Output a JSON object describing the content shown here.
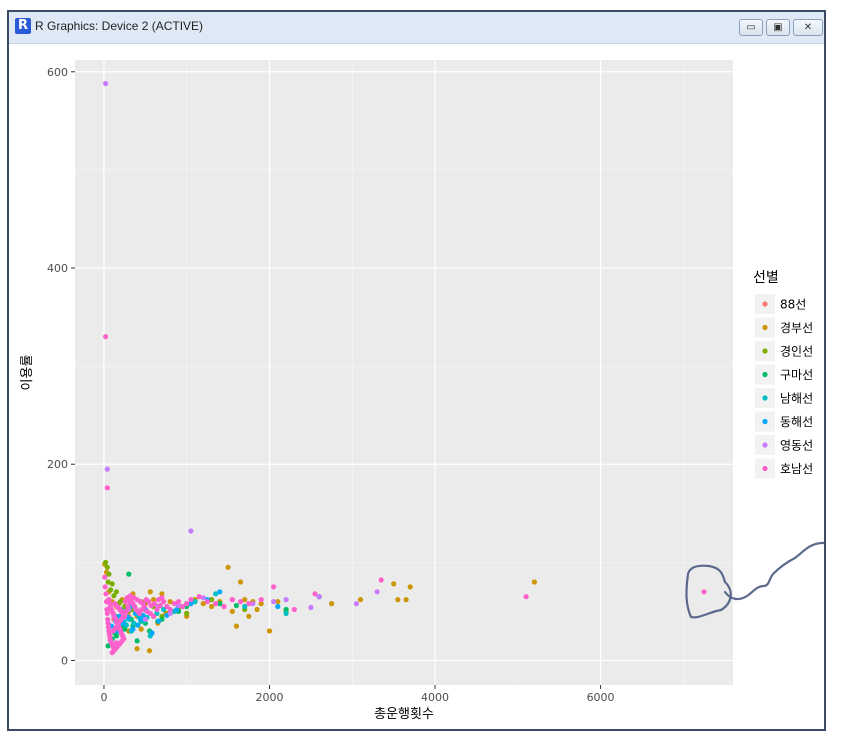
{
  "window": {
    "title": "R Graphics: Device 2 (ACTIVE)",
    "app_icon_glyph": "R",
    "minimize_glyph": "▭",
    "maximize_glyph": "▣",
    "close_glyph": "✕"
  },
  "chart_data": {
    "type": "scatter",
    "title": "",
    "xlabel": "총운행횟수",
    "ylabel": "이용률",
    "xlim": [
      -350,
      7600
    ],
    "ylim": [
      -25,
      612
    ],
    "x_ticks": [
      0,
      2000,
      4000,
      6000
    ],
    "y_ticks": [
      0,
      200,
      400,
      600
    ],
    "x_tick_labels": [
      "0",
      "2000",
      "4000",
      "6000"
    ],
    "y_tick_labels": [
      "0",
      "200",
      "400",
      "600"
    ],
    "grid": true,
    "background": "#ebebeb",
    "legend": {
      "title": "선별",
      "position": "right"
    },
    "series": [
      {
        "name": "88선",
        "color": "#F8766D",
        "points": [
          [
            120,
            42
          ],
          [
            180,
            38
          ],
          [
            240,
            50
          ],
          [
            300,
            45
          ]
        ]
      },
      {
        "name": "경부선",
        "color": "#CD9600",
        "points": [
          [
            10,
            98
          ],
          [
            30,
            90
          ],
          [
            60,
            70
          ],
          [
            100,
            60
          ],
          [
            150,
            55
          ],
          [
            220,
            62
          ],
          [
            280,
            50
          ],
          [
            350,
            68
          ],
          [
            400,
            45
          ],
          [
            450,
            60
          ],
          [
            500,
            58
          ],
          [
            560,
            70
          ],
          [
            600,
            62
          ],
          [
            650,
            55
          ],
          [
            700,
            68
          ],
          [
            750,
            48
          ],
          [
            800,
            60
          ],
          [
            900,
            55
          ],
          [
            1000,
            45
          ],
          [
            1100,
            62
          ],
          [
            1200,
            58
          ],
          [
            1300,
            55
          ],
          [
            1400,
            60
          ],
          [
            1500,
            95
          ],
          [
            1550,
            50
          ],
          [
            1600,
            35
          ],
          [
            1650,
            80
          ],
          [
            1700,
            62
          ],
          [
            1750,
            45
          ],
          [
            1800,
            60
          ],
          [
            1850,
            52
          ],
          [
            1900,
            58
          ],
          [
            2000,
            30
          ],
          [
            2100,
            60
          ],
          [
            2200,
            50
          ],
          [
            2600,
            65
          ],
          [
            2750,
            58
          ],
          [
            3100,
            62
          ],
          [
            3500,
            78
          ],
          [
            3550,
            62
          ],
          [
            3650,
            62
          ],
          [
            3700,
            75
          ],
          [
            5200,
            80
          ],
          [
            300,
            30
          ],
          [
            400,
            12
          ],
          [
            550,
            10
          ],
          [
            650,
            38
          ],
          [
            450,
            32
          ],
          [
            1000,
            58
          ],
          [
            1300,
            62
          ]
        ]
      },
      {
        "name": "경인선",
        "color": "#7CAE00",
        "points": [
          [
            20,
            100
          ],
          [
            40,
            95
          ],
          [
            60,
            88
          ],
          [
            100,
            78
          ],
          [
            150,
            70
          ],
          [
            200,
            60
          ],
          [
            250,
            55
          ],
          [
            300,
            50
          ],
          [
            400,
            48
          ],
          [
            500,
            60
          ],
          [
            600,
            55
          ],
          [
            700,
            45
          ],
          [
            800,
            50
          ],
          [
            900,
            52
          ],
          [
            1000,
            48
          ],
          [
            1100,
            60
          ],
          [
            1300,
            62
          ],
          [
            1700,
            52
          ],
          [
            50,
            80
          ],
          [
            80,
            72
          ],
          [
            120,
            66
          ],
          [
            180,
            58
          ],
          [
            350,
            52
          ],
          [
            450,
            46
          ]
        ]
      },
      {
        "name": "구마선",
        "color": "#00BE67",
        "points": [
          [
            50,
            15
          ],
          [
            100,
            22
          ],
          [
            150,
            25
          ],
          [
            200,
            30
          ],
          [
            250,
            32
          ],
          [
            300,
            88
          ],
          [
            350,
            35
          ],
          [
            400,
            20
          ],
          [
            450,
            40
          ],
          [
            500,
            38
          ],
          [
            600,
            45
          ],
          [
            700,
            42
          ],
          [
            900,
            50
          ],
          [
            1000,
            55
          ],
          [
            2200,
            52
          ],
          [
            2600,
            65
          ],
          [
            130,
            28
          ],
          [
            220,
            35
          ],
          [
            330,
            42
          ],
          [
            550,
            30
          ],
          [
            650,
            40
          ],
          [
            800,
            48
          ],
          [
            1400,
            58
          ],
          [
            1600,
            56
          ]
        ]
      },
      {
        "name": "남해선",
        "color": "#00BFC4",
        "points": [
          [
            80,
            20
          ],
          [
            120,
            30
          ],
          [
            180,
            35
          ],
          [
            240,
            40
          ],
          [
            300,
            42
          ],
          [
            360,
            38
          ],
          [
            420,
            45
          ],
          [
            480,
            40
          ],
          [
            560,
            25
          ],
          [
            640,
            48
          ],
          [
            720,
            52
          ],
          [
            850,
            50
          ],
          [
            950,
            55
          ],
          [
            1100,
            60
          ],
          [
            1350,
            68
          ],
          [
            1700,
            55
          ],
          [
            2200,
            48
          ],
          [
            150,
            45
          ],
          [
            200,
            52
          ],
          [
            270,
            36
          ],
          [
            330,
            30
          ],
          [
            390,
            48
          ],
          [
            460,
            52
          ],
          [
            520,
            44
          ]
        ]
      },
      {
        "name": "동해선",
        "color": "#00A9FF",
        "points": [
          [
            90,
            35
          ],
          [
            140,
            40
          ],
          [
            190,
            45
          ],
          [
            260,
            50
          ],
          [
            320,
            55
          ],
          [
            380,
            48
          ],
          [
            440,
            42
          ],
          [
            500,
            52
          ],
          [
            580,
            28
          ],
          [
            660,
            40
          ],
          [
            760,
            46
          ],
          [
            880,
            52
          ],
          [
            1050,
            58
          ],
          [
            1250,
            62
          ],
          [
            1400,
            70
          ],
          [
            2100,
            55
          ],
          [
            170,
            30
          ],
          [
            230,
            38
          ],
          [
            290,
            44
          ],
          [
            350,
            32
          ],
          [
            410,
            36
          ],
          [
            470,
            46
          ]
        ]
      },
      {
        "name": "영동선",
        "color": "#C77CFF",
        "points": [
          [
            20,
            588
          ],
          [
            40,
            195
          ],
          [
            1050,
            132
          ],
          [
            1550,
            62
          ],
          [
            2050,
            60
          ],
          [
            2600,
            65
          ],
          [
            3050,
            58
          ],
          [
            3300,
            70
          ],
          [
            650,
            55
          ],
          [
            800,
            48
          ],
          [
            120,
            45
          ],
          [
            300,
            52
          ],
          [
            500,
            42
          ],
          [
            900,
            56
          ],
          [
            1200,
            64
          ],
          [
            1800,
            58
          ],
          [
            2200,
            62
          ],
          [
            2500,
            54
          ]
        ]
      },
      {
        "name": "호남선",
        "color": "#FF61CC",
        "points": [
          [
            20,
            330
          ],
          [
            40,
            176
          ],
          [
            10,
            85
          ],
          [
            15,
            75
          ],
          [
            25,
            68
          ],
          [
            30,
            60
          ],
          [
            35,
            52
          ],
          [
            40,
            48
          ],
          [
            45,
            42
          ],
          [
            50,
            38
          ],
          [
            55,
            34
          ],
          [
            60,
            30
          ],
          [
            65,
            28
          ],
          [
            70,
            25
          ],
          [
            75,
            22
          ],
          [
            80,
            20
          ],
          [
            90,
            18
          ],
          [
            100,
            16
          ],
          [
            110,
            14
          ],
          [
            120,
            12
          ],
          [
            130,
            14
          ],
          [
            140,
            16
          ],
          [
            150,
            18
          ],
          [
            60,
            62
          ],
          [
            70,
            58
          ],
          [
            80,
            55
          ],
          [
            90,
            52
          ],
          [
            100,
            50
          ],
          [
            110,
            48
          ],
          [
            120,
            46
          ],
          [
            130,
            44
          ],
          [
            140,
            42
          ],
          [
            150,
            40
          ],
          [
            160,
            38
          ],
          [
            170,
            36
          ],
          [
            180,
            34
          ],
          [
            190,
            32
          ],
          [
            200,
            30
          ],
          [
            210,
            28
          ],
          [
            220,
            26
          ],
          [
            230,
            24
          ],
          [
            240,
            22
          ],
          [
            100,
            8
          ],
          [
            120,
            10
          ],
          [
            140,
            12
          ],
          [
            160,
            14
          ],
          [
            180,
            16
          ],
          [
            200,
            18
          ],
          [
            220,
            20
          ],
          [
            250,
            45
          ],
          [
            270,
            50
          ],
          [
            290,
            55
          ],
          [
            310,
            60
          ],
          [
            330,
            62
          ],
          [
            350,
            58
          ],
          [
            370,
            55
          ],
          [
            390,
            52
          ],
          [
            410,
            50
          ],
          [
            430,
            48
          ],
          [
            460,
            52
          ],
          [
            490,
            55
          ],
          [
            520,
            50
          ],
          [
            560,
            48
          ],
          [
            600,
            45
          ],
          [
            640,
            52
          ],
          [
            680,
            56
          ],
          [
            720,
            60
          ],
          [
            760,
            55
          ],
          [
            800,
            52
          ],
          [
            850,
            58
          ],
          [
            900,
            60
          ],
          [
            950,
            55
          ],
          [
            1000,
            58
          ],
          [
            1050,
            62
          ],
          [
            1150,
            65
          ],
          [
            1250,
            60
          ],
          [
            1350,
            58
          ],
          [
            1450,
            55
          ],
          [
            1550,
            62
          ],
          [
            1650,
            60
          ],
          [
            1750,
            58
          ],
          [
            1900,
            62
          ],
          [
            2050,
            75
          ],
          [
            2300,
            52
          ],
          [
            2550,
            68
          ],
          [
            3350,
            82
          ],
          [
            5100,
            65
          ],
          [
            7250,
            70
          ],
          [
            130,
            58
          ],
          [
            150,
            56
          ],
          [
            170,
            54
          ],
          [
            190,
            52
          ],
          [
            210,
            50
          ],
          [
            230,
            48
          ],
          [
            260,
            60
          ],
          [
            280,
            64
          ],
          [
            320,
            66
          ],
          [
            360,
            64
          ],
          [
            400,
            62
          ],
          [
            440,
            60
          ],
          [
            470,
            58
          ],
          [
            510,
            62
          ],
          [
            540,
            60
          ],
          [
            570,
            56
          ],
          [
            610,
            58
          ],
          [
            660,
            62
          ],
          [
            700,
            64
          ],
          [
            110,
            30
          ],
          [
            130,
            32
          ],
          [
            150,
            34
          ],
          [
            170,
            38
          ],
          [
            190,
            40
          ],
          [
            210,
            42
          ],
          [
            230,
            44
          ]
        ]
      }
    ]
  },
  "annotation": {
    "stroke": "#5b6a8c"
  }
}
